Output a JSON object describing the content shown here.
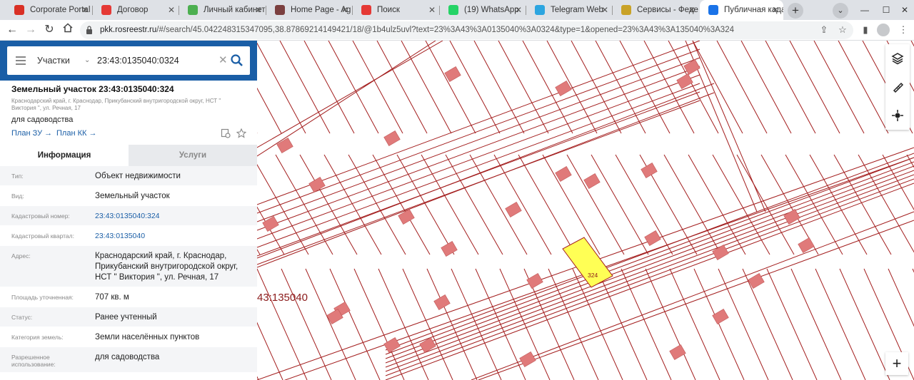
{
  "browser": {
    "tabs": [
      {
        "title": "Corporate Portal",
        "icon": "portal-favicon-icon",
        "color": "#d93025"
      },
      {
        "title": "Договор",
        "icon": "document-favicon-icon",
        "color": "#e53935"
      },
      {
        "title": "Личный кабинет",
        "icon": "cabinet-favicon-icon",
        "color": "#4caf50"
      },
      {
        "title": "Home Page - Ag",
        "icon": "home-favicon-icon",
        "color": "#7b3f3f"
      },
      {
        "title": "Поиск",
        "icon": "search-favicon-icon",
        "color": "#e53935"
      },
      {
        "title": "(19) WhatsApp",
        "icon": "whatsapp-icon",
        "color": "#25d366"
      },
      {
        "title": "Telegram Web",
        "icon": "telegram-icon",
        "color": "#2ca5e0"
      },
      {
        "title": "Сервисы - Феде",
        "icon": "emblem-icon",
        "color": "#c9a227"
      },
      {
        "title": "Публичная када",
        "icon": "rosreestr-favicon-icon",
        "color": "#1a73e8"
      }
    ],
    "url_domain": "pkk.rosreestr.ru",
    "url_rest": "/#/search/45.042248315347095,38.87869214149421/18/@1b4ulz5uvl?text=23%3A43%3A0135040%3A0324&type=1&opened=23%3A43%3A135040%3A324"
  },
  "search": {
    "type_label": "Участки",
    "query": "23:43:0135040:0324",
    "clear_symbol": "✕"
  },
  "object": {
    "title": "Земельный участок 23:43:0135040:324",
    "address_short": "Краснодарский край, г. Краснодар, Прикубанский внутригородской округ, НСТ \" Виктория \", ул. Речная, 17",
    "usage": "для садоводства",
    "plan_zu": "План ЗУ →",
    "plan_kk": "План КК →"
  },
  "tabs": {
    "info": "Информация",
    "services": "Услуги"
  },
  "fields": [
    {
      "label": "Тип:",
      "value": "Объект недвижимости",
      "link": false
    },
    {
      "label": "Вид:",
      "value": "Земельный участок",
      "link": false
    },
    {
      "label": "Кадастровый номер:",
      "value": "23:43:0135040:324",
      "link": true
    },
    {
      "label": "Кадастровый квартал:",
      "value": "23:43:0135040",
      "link": true
    },
    {
      "label": "Адрес:",
      "value": "Краснодарский край, г. Краснодар, Прикубанский внутригородской округ, НСТ \" Виктория \", ул. Речная, 17",
      "link": false
    },
    {
      "label": "Площадь уточненная:",
      "value": "707 кв. м",
      "link": false
    },
    {
      "label": "Статус:",
      "value": "Ранее учтенный",
      "link": false
    },
    {
      "label": "Категория земель:",
      "value": "Земли населённых пунктов",
      "link": false
    },
    {
      "label": "Разрешенное использование:",
      "value": "для садоводства",
      "link": false
    }
  ],
  "map": {
    "quarter_label": "43:135040",
    "selected_parcel": "324",
    "colors": {
      "boundary": "#9b1b1b",
      "building": "#e07a7a",
      "selected": "#ffff55",
      "label": "#8b1a1a"
    }
  }
}
